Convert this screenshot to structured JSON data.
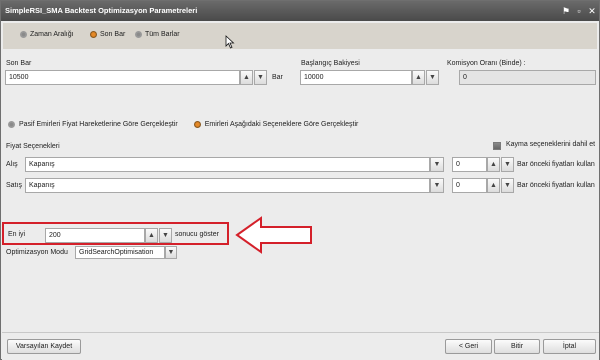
{
  "window": {
    "title": "SimpleRSI_SMA Backtest Optimizasyon Parametreleri"
  },
  "range_options": [
    {
      "label": "Zaman Aralığı",
      "selected": false
    },
    {
      "label": "Son Bar",
      "selected": true
    },
    {
      "label": "Tüm Barlar",
      "selected": false
    }
  ],
  "son_bar": {
    "label": "Son Bar",
    "value": "10500",
    "unit": "Bar"
  },
  "baslangic": {
    "label": "Başlangıç Bakiyesi",
    "value": "10000"
  },
  "komisyon": {
    "label": "Komisyon Oranı (Binde) :",
    "value": "0"
  },
  "execution_options": [
    {
      "label": "Pasif Emirleri Fiyat Hareketlerine Göre Gerçekleştir",
      "selected": false
    },
    {
      "label": "Emirleri Aşağıdaki Seçeneklere Göre Gerçekleştir",
      "selected": true
    }
  ],
  "fiyat": {
    "section_label": "Fiyat Seçenekleri",
    "slippage_label": "Kayma seçeneklerini dahil et",
    "rows": [
      {
        "label": "Alış",
        "price": "Kapanış",
        "offset": "0",
        "suffix": "Bar önceki fiyatları kullan"
      },
      {
        "label": "Satış",
        "price": "Kapanış",
        "offset": "0",
        "suffix": "Bar önceki fiyatları kullan"
      }
    ]
  },
  "en_iyi": {
    "label": "En iyi",
    "value": "200",
    "suffix": "sonucu göster"
  },
  "optimizasyon": {
    "label": "Optimizasyon Modu",
    "value": "GridSearchOptimisation"
  },
  "footer": {
    "save_defaults": "Varsayılan Kaydet",
    "back": "< Geri",
    "finish": "Bitir",
    "cancel": "İptal"
  },
  "colors": {
    "titlebar": "#4a4a4a",
    "radio_bar": "#d8d4cc",
    "highlight": "#d4202a",
    "radio_selected": "#e58a28"
  }
}
